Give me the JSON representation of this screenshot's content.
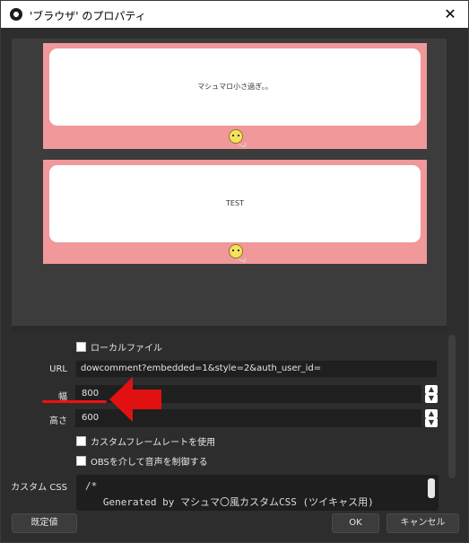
{
  "window": {
    "title": "'ブラウザ' のプロパティ",
    "close_glyph": "✕"
  },
  "preview": {
    "cards": [
      {
        "text": "マシュマロ小さ過ぎ。。"
      },
      {
        "text": "TEST"
      }
    ]
  },
  "props": {
    "local_file_label": "ローカルファイル",
    "url_label": "URL",
    "url_value": "dowcomment?embedded=1&style=2&auth_user_id=",
    "width_label": "幅",
    "width_value": "800",
    "height_label": "高さ",
    "height_value": "600",
    "custom_framerate_label": "カスタムフレームレートを使用",
    "obs_audio_label": "OBSを介して音声を制御する",
    "custom_css_label": "カスタム CSS",
    "custom_css_lines": [
      "/*",
      "   Generated by マシュマ〇風カスタムCSS (ツイキャス用)"
    ]
  },
  "buttons": {
    "defaults": "既定値",
    "ok": "OK",
    "cancel": "キャンセル"
  },
  "colors": {
    "card_pink": "#f0989a",
    "annotation_red": "#e11111",
    "field_bg": "#1f1f1f"
  }
}
